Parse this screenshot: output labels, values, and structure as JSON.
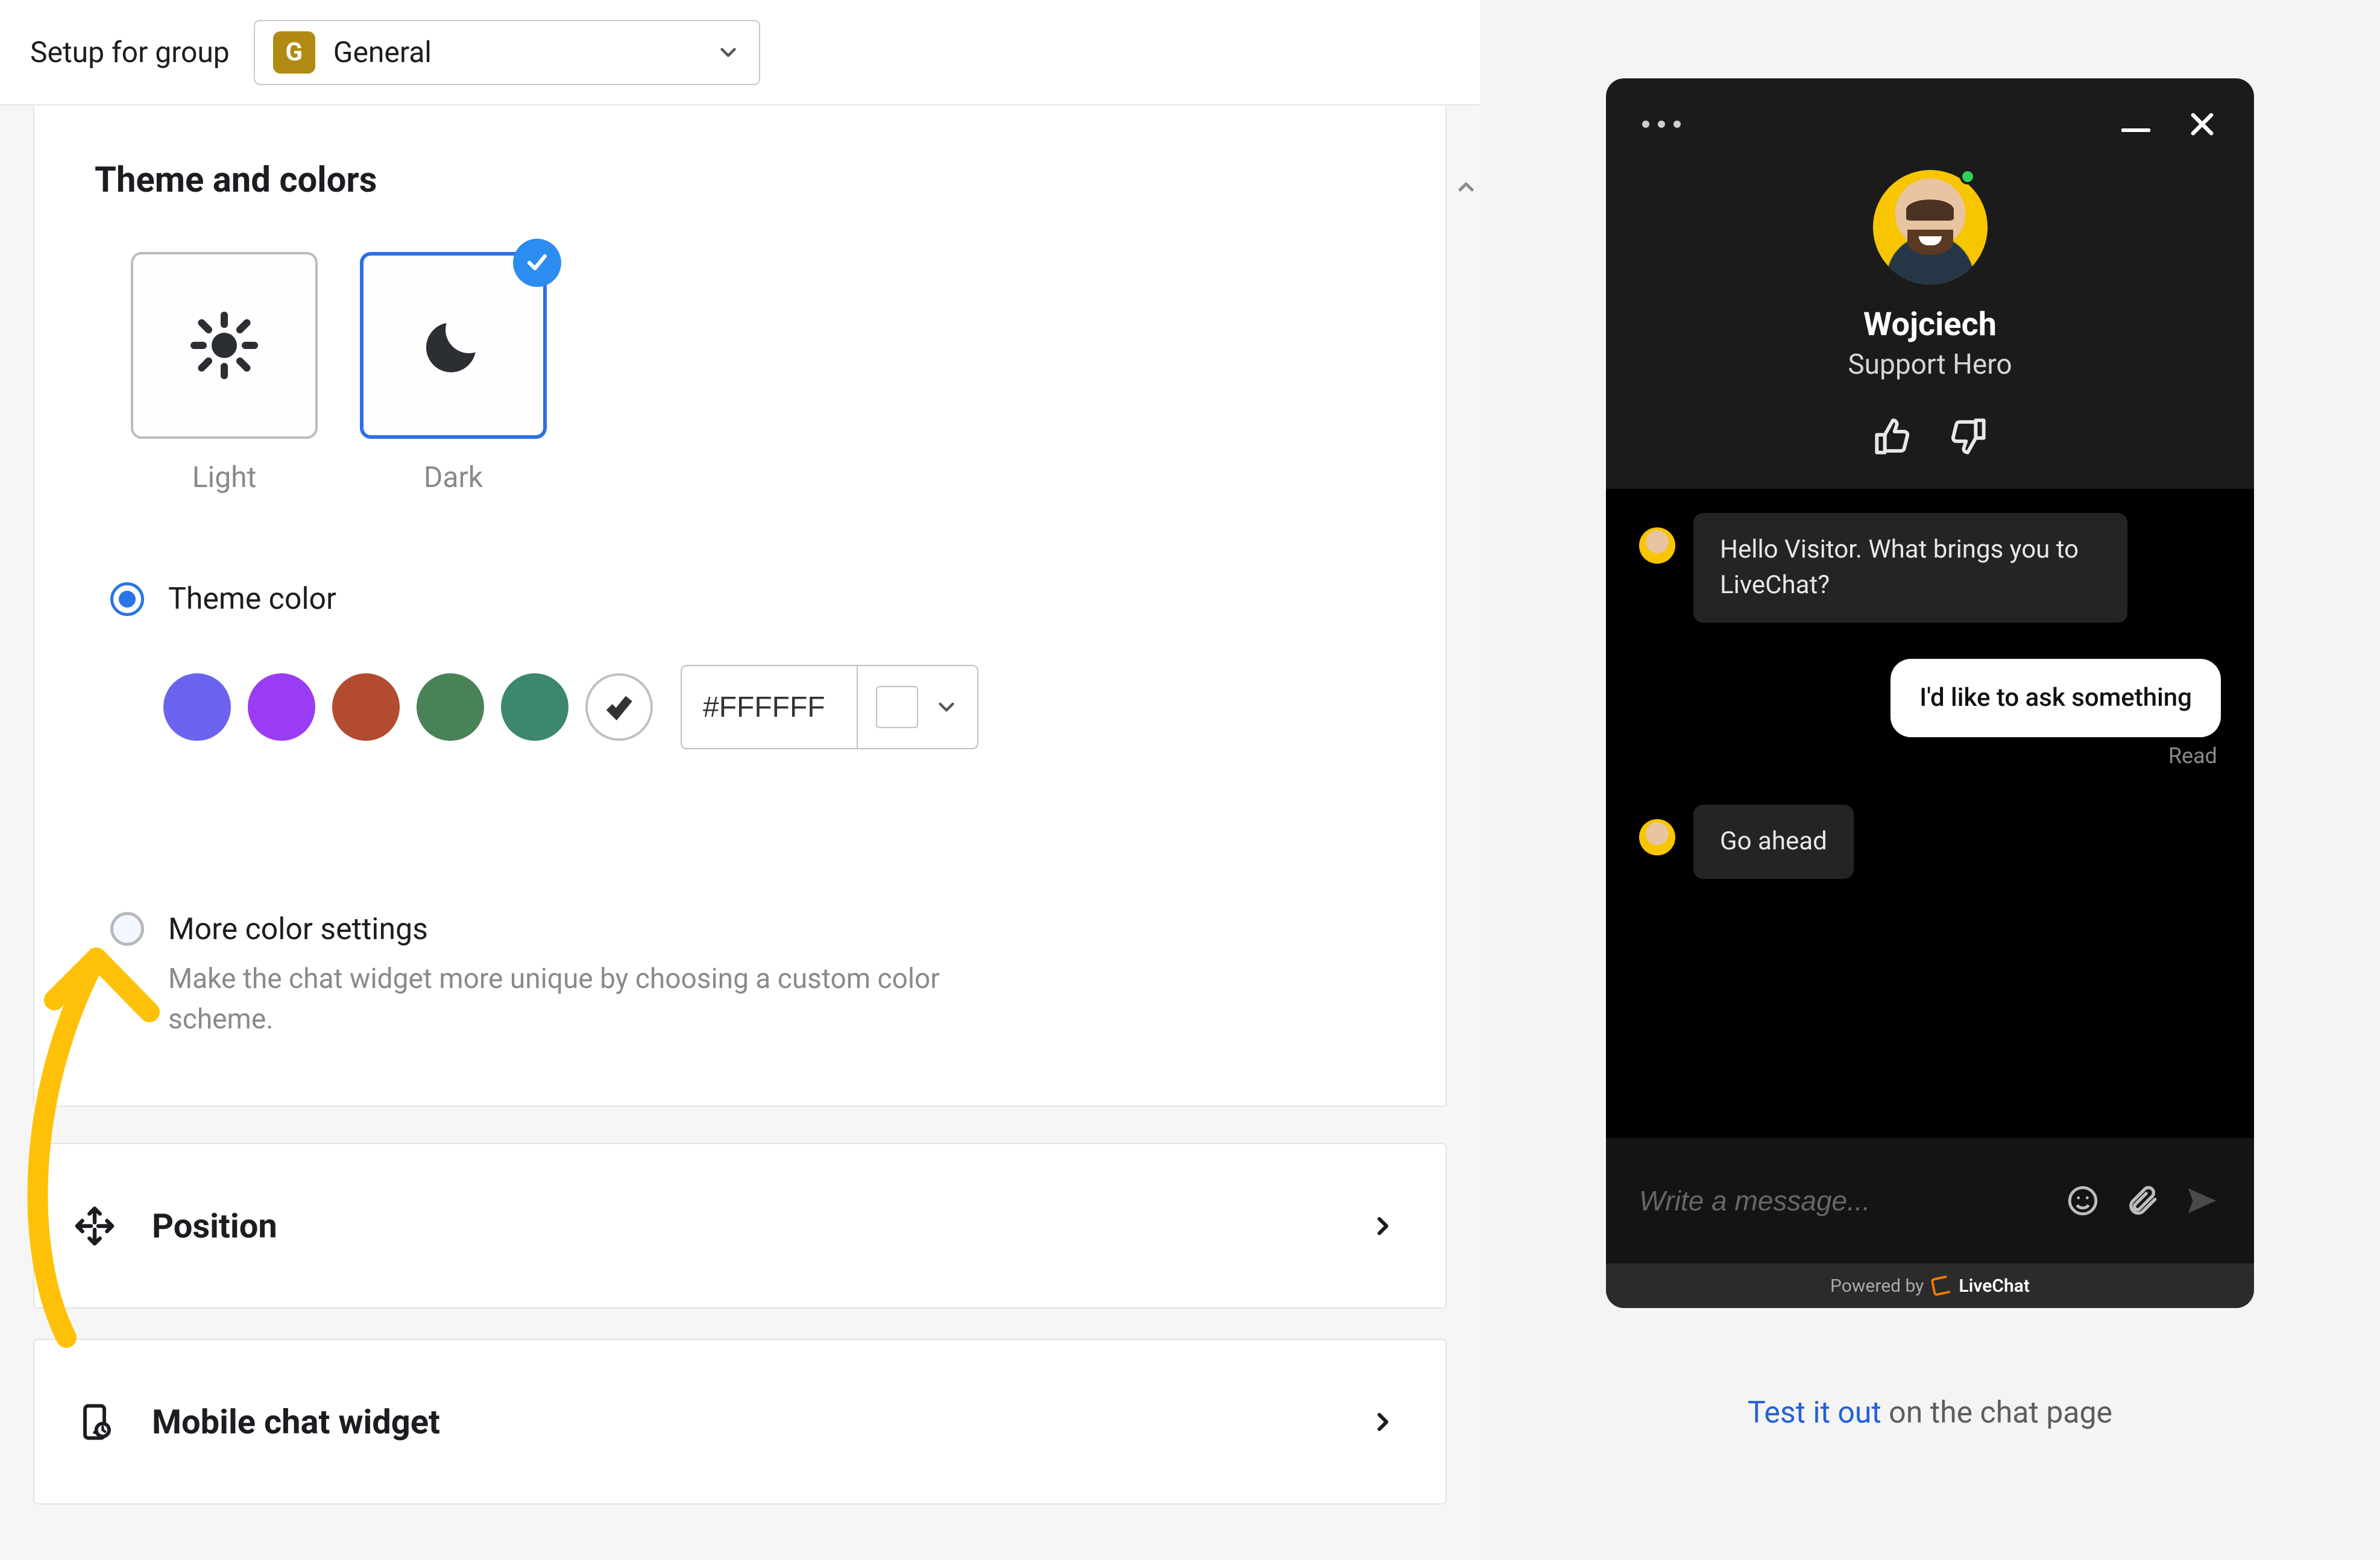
{
  "header": {
    "label": "Setup for group",
    "group_badge": "G",
    "group_name": "General"
  },
  "theme_section": {
    "title": "Theme and colors",
    "options": {
      "light": "Light",
      "dark": "Dark"
    },
    "selected": "dark",
    "theme_color_label": "Theme color",
    "colors": [
      "#6a63ef",
      "#9a3cf4",
      "#b34b30",
      "#4a8258",
      "#3b8770"
    ],
    "custom_hex": "#FFFFFF",
    "more_label": "More color settings",
    "more_desc": "Make the chat widget more unique by choosing a custom color scheme."
  },
  "nav_cards": {
    "position": "Position",
    "mobile": "Mobile chat widget"
  },
  "widget": {
    "agent_name": "Wojciech",
    "agent_role": "Support Hero",
    "messages": {
      "m1": "Hello Visitor. What brings you to LiveChat?",
      "m2": "I'd like to ask something",
      "m2_status": "Read",
      "m3": "Go ahead"
    },
    "input_placeholder": "Write a message...",
    "footer_prefix": "Powered by",
    "footer_brand": "LiveChat"
  },
  "cta": {
    "link": "Test it out",
    "rest": " on the chat page"
  }
}
